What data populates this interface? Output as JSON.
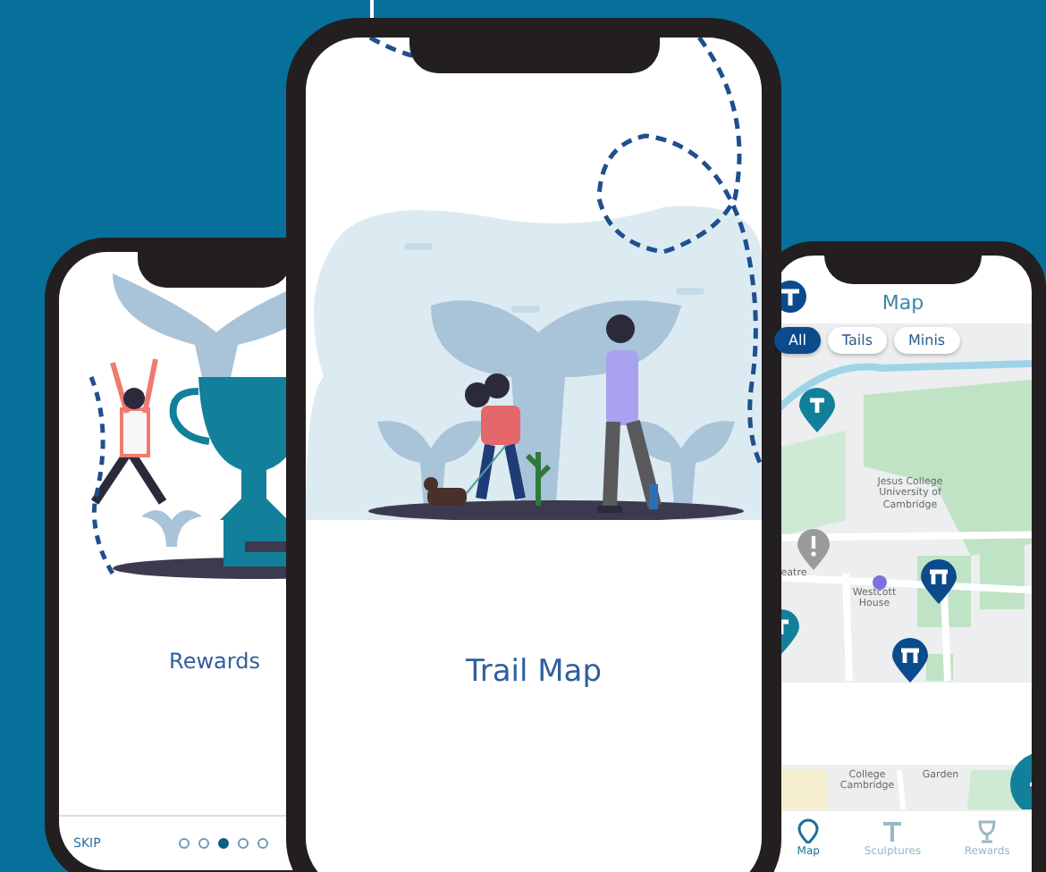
{
  "phones": [
    {
      "kind": "onboarding",
      "title": "Rewards",
      "skip": "SKIP",
      "dots": [
        {
          "selected": false
        },
        {
          "selected": false
        },
        {
          "selected": true
        },
        {
          "selected": false
        },
        {
          "selected": false
        }
      ]
    },
    {
      "kind": "intro",
      "title": "Trail Map"
    },
    {
      "kind": "map",
      "title": "Map",
      "filters": [
        {
          "label": "All",
          "selected": true
        },
        {
          "label": "Tails",
          "selected": false
        },
        {
          "label": "Minis",
          "selected": false
        }
      ],
      "map_labels": [
        "Jesus College University of Cambridge",
        "Westcott House",
        "eatre",
        "College Cambridge",
        "Garden"
      ],
      "nav": [
        {
          "label": "Map",
          "selected": true
        },
        {
          "label": "Sculptures",
          "selected": false
        },
        {
          "label": "Rewards",
          "selected": false
        }
      ]
    }
  ]
}
